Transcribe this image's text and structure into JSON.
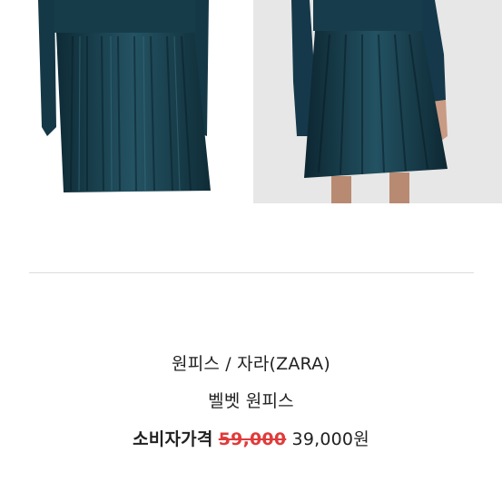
{
  "images": {
    "left": "product-photo-flat-dress",
    "right": "product-photo-model-wearing-dress"
  },
  "product": {
    "category_brand": "원피스 / 자라(ZARA)",
    "name": "벨벳 원피스",
    "price_label": "소비자가격",
    "original_price": "59,000",
    "sale_price": "39,000원"
  },
  "colors": {
    "velvet": "#173a48",
    "strike": "#e03b3b"
  }
}
